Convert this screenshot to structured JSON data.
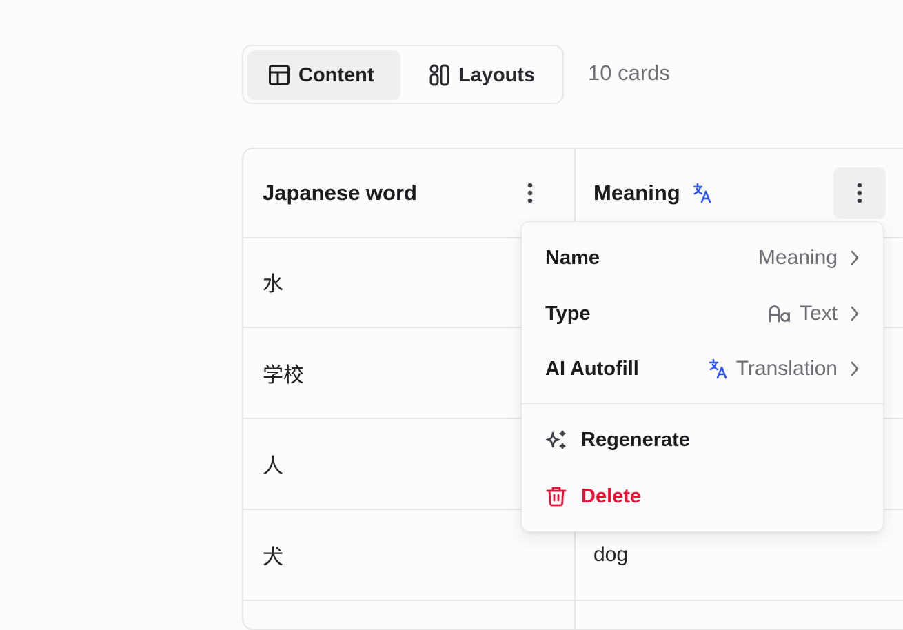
{
  "view_tabs": [
    {
      "label": "Content",
      "icon": "table-icon",
      "active": true
    },
    {
      "label": "Layouts",
      "icon": "layouts-icon",
      "active": false
    }
  ],
  "card_count": "10 cards",
  "table": {
    "columns": [
      {
        "title": "Japanese word",
        "has_translate_icon": false
      },
      {
        "title": "Meaning",
        "has_translate_icon": true
      }
    ],
    "rows": [
      {
        "word": "水",
        "meaning": ""
      },
      {
        "word": "学校",
        "meaning": ""
      },
      {
        "word": "人",
        "meaning": ""
      },
      {
        "word": "犬",
        "meaning": "dog"
      }
    ]
  },
  "column_menu": {
    "name": {
      "label": "Name",
      "value": "Meaning"
    },
    "type": {
      "label": "Type",
      "value": "Text",
      "icon": "text-type-icon"
    },
    "autofill": {
      "label": "AI Autofill",
      "value": "Translation",
      "icon": "translate-icon"
    },
    "regenerate": {
      "label": "Regenerate",
      "icon": "sparkles-icon"
    },
    "delete": {
      "label": "Delete",
      "icon": "trash-icon"
    }
  },
  "colors": {
    "accent_blue": "#2f55f5",
    "danger_red": "#ee0f34",
    "muted_text": "#6e6e76"
  }
}
